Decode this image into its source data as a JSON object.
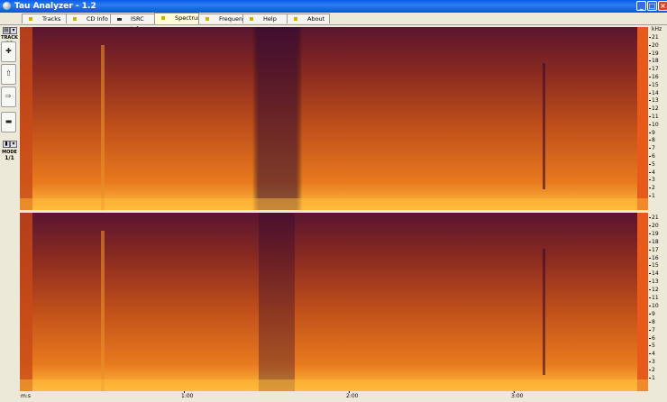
{
  "window": {
    "title": "Tau Analyzer - 1.2"
  },
  "tabs": [
    {
      "label": "Tracks",
      "active": false
    },
    {
      "label": "CD Info",
      "active": false
    },
    {
      "label": "ISRC Info",
      "active": false
    },
    {
      "label": "Spectrum",
      "active": true
    },
    {
      "label": "Frequency",
      "active": false
    },
    {
      "label": "Help",
      "active": false
    },
    {
      "label": "About",
      "active": false
    }
  ],
  "left_panel": {
    "track_label": "TRACK",
    "track_number": "01",
    "mode_label": "MODE",
    "mode_value": "1/1",
    "buttons": [
      "zoom-in",
      "up",
      "right",
      "stop"
    ]
  },
  "frequency_axis": {
    "unit": "kHz",
    "ticks": [
      "21",
      "20",
      "19",
      "18",
      "17",
      "16",
      "15",
      "14",
      "13",
      "12",
      "11",
      "10",
      "9",
      "8",
      "7",
      "6",
      "5",
      "4",
      "3",
      "2",
      "1"
    ]
  },
  "time_axis": {
    "unit": "m:s",
    "ticks": [
      "1:00",
      "2:00",
      "3:00"
    ]
  },
  "colors": {
    "spectrum_low": "#3a0a30",
    "spectrum_mid": "#c8501a",
    "spectrum_high": "#ffd040",
    "titlebar": "#0a5ce8"
  }
}
